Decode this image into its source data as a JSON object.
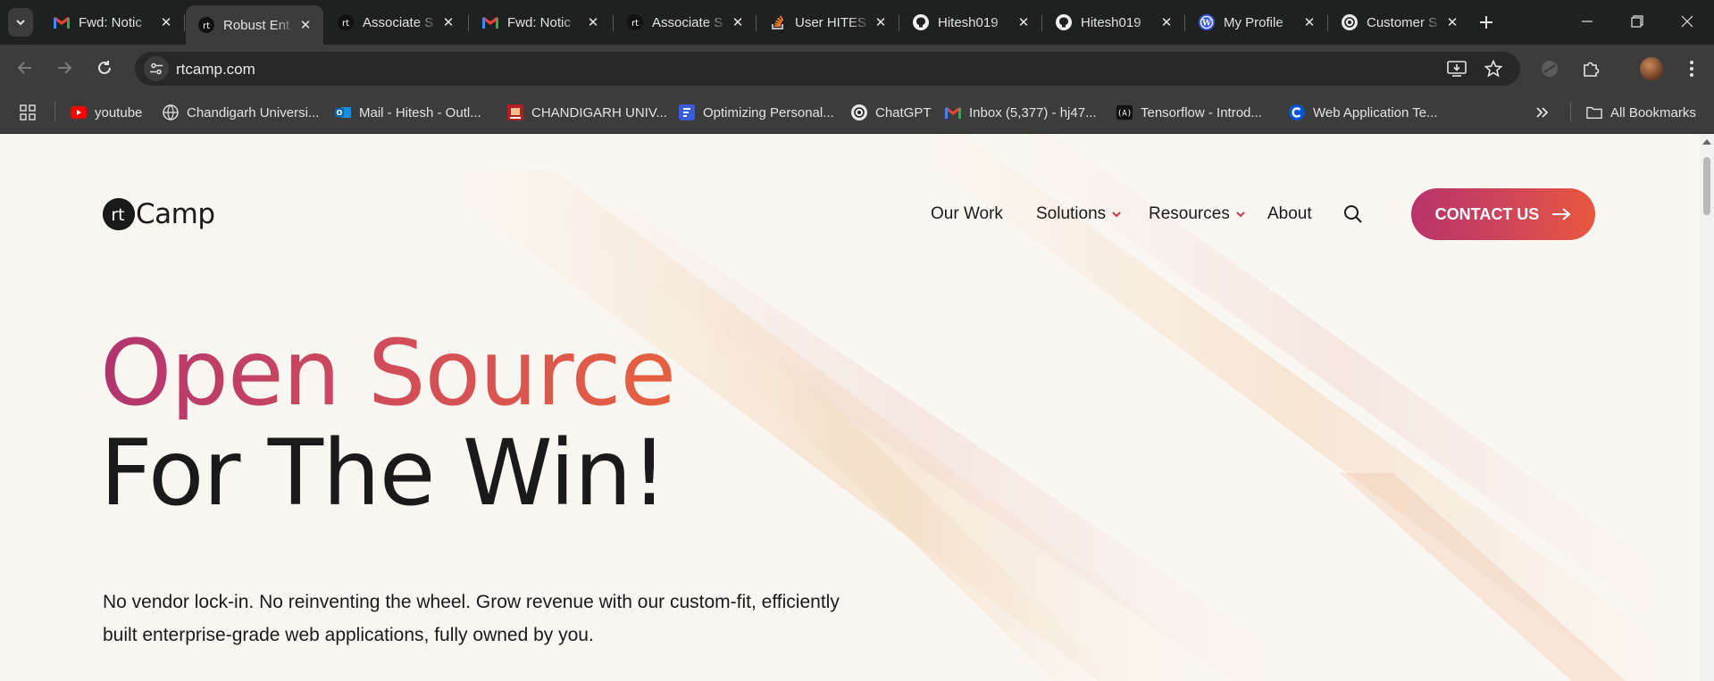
{
  "browser": {
    "tabs": [
      {
        "title": "Fwd: Notic",
        "icon": "gmail-icon",
        "active": false
      },
      {
        "title": "Robust Ent",
        "icon": "rtcamp-icon",
        "active": true
      },
      {
        "title": "Associate S",
        "icon": "rtcamp-icon",
        "active": false
      },
      {
        "title": "Fwd: Notic",
        "icon": "gmail-icon",
        "active": false
      },
      {
        "title": "Associate S",
        "icon": "rtcamp-icon",
        "active": false
      },
      {
        "title": "User HITES",
        "icon": "stackoverflow-icon",
        "active": false
      },
      {
        "title": "Hitesh019",
        "icon": "github-icon",
        "active": false
      },
      {
        "title": "Hitesh019",
        "icon": "github-icon",
        "active": false
      },
      {
        "title": "My Profile",
        "icon": "wordpress-icon",
        "active": false
      },
      {
        "title": "Customer S",
        "icon": "chatgpt-icon",
        "active": false
      }
    ],
    "address": "rtcamp.com",
    "bookmarks": [
      {
        "label": "youtube",
        "icon": "youtube-icon"
      },
      {
        "label": "Chandigarh Universi...",
        "icon": "globe-icon"
      },
      {
        "label": "Mail - Hitesh - Outl...",
        "icon": "outlook-icon"
      },
      {
        "label": "CHANDIGARH UNIV...",
        "icon": "cu-icon"
      },
      {
        "label": "Optimizing Personal...",
        "icon": "forms-icon"
      },
      {
        "label": "ChatGPT",
        "icon": "chatgpt-icon"
      },
      {
        "label": "Inbox (5,377) - hj47...",
        "icon": "gmail-icon"
      },
      {
        "label": "Tensorflow - Introd...",
        "icon": "tensorflow-icon"
      },
      {
        "label": "Web Application Te...",
        "icon": "coursera-icon"
      }
    ],
    "all_bookmarks_label": "All Bookmarks"
  },
  "site": {
    "logo_text": "Camp",
    "nav": {
      "our_work": "Our Work",
      "solutions": "Solutions",
      "resources": "Resources",
      "about": "About"
    },
    "cta_label": "CONTACT US",
    "hero_line1": "Open Source",
    "hero_line2": "For The Win!",
    "subtitle_line1": "No vendor lock-in. No reinventing the wheel. Grow revenue with our custom-fit, efficiently",
    "subtitle_line2": "built enterprise-grade web applications, fully owned by you."
  },
  "colors": {
    "brand_gradient_start": "#b0356e",
    "brand_gradient_end": "#e6613f",
    "chrome_dark": "#1f2020",
    "chrome_toolbar": "#3c3c3c",
    "page_bg": "#faf7f2"
  }
}
